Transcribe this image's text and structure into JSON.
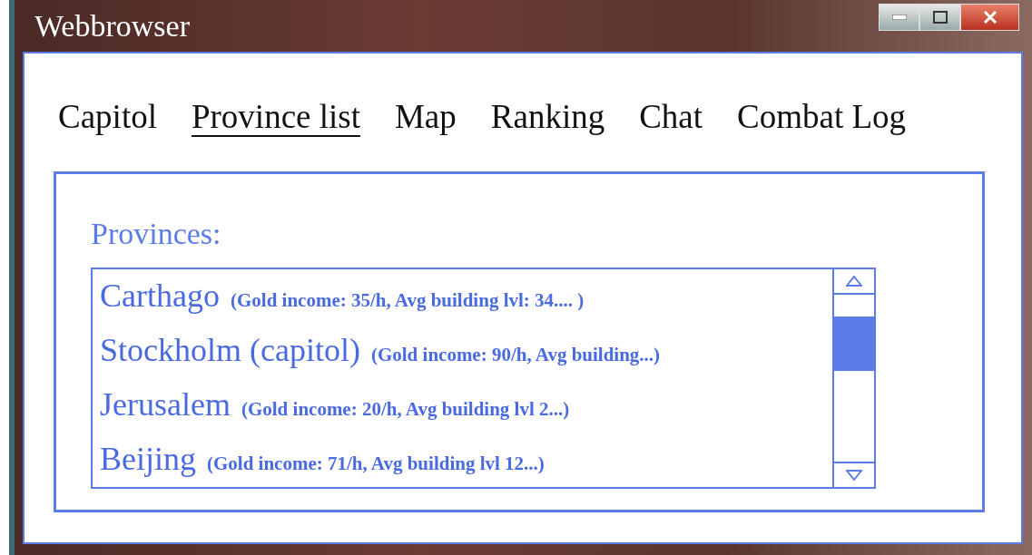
{
  "window": {
    "title": "Webbrowser"
  },
  "tabs": [
    {
      "label": "Capitol",
      "selected": false
    },
    {
      "label": "Province list",
      "selected": true
    },
    {
      "label": "Map",
      "selected": false
    },
    {
      "label": "Ranking",
      "selected": false
    },
    {
      "label": "Chat",
      "selected": false
    },
    {
      "label": "Combat Log",
      "selected": false
    }
  ],
  "panel": {
    "heading": "Provinces:",
    "provinces": [
      {
        "name": "Carthago",
        "details": "(Gold income: 35/h, Avg building lvl: 34.... )"
      },
      {
        "name": "Stockholm (capitol)",
        "details": "(Gold income: 90/h, Avg building...)"
      },
      {
        "name": "Jerusalem",
        "details": "(Gold income: 20/h, Avg building lvl 2...)"
      },
      {
        "name": "Beijing",
        "details": "(Gold income: 71/h, Avg building lvl 12...)"
      }
    ]
  }
}
